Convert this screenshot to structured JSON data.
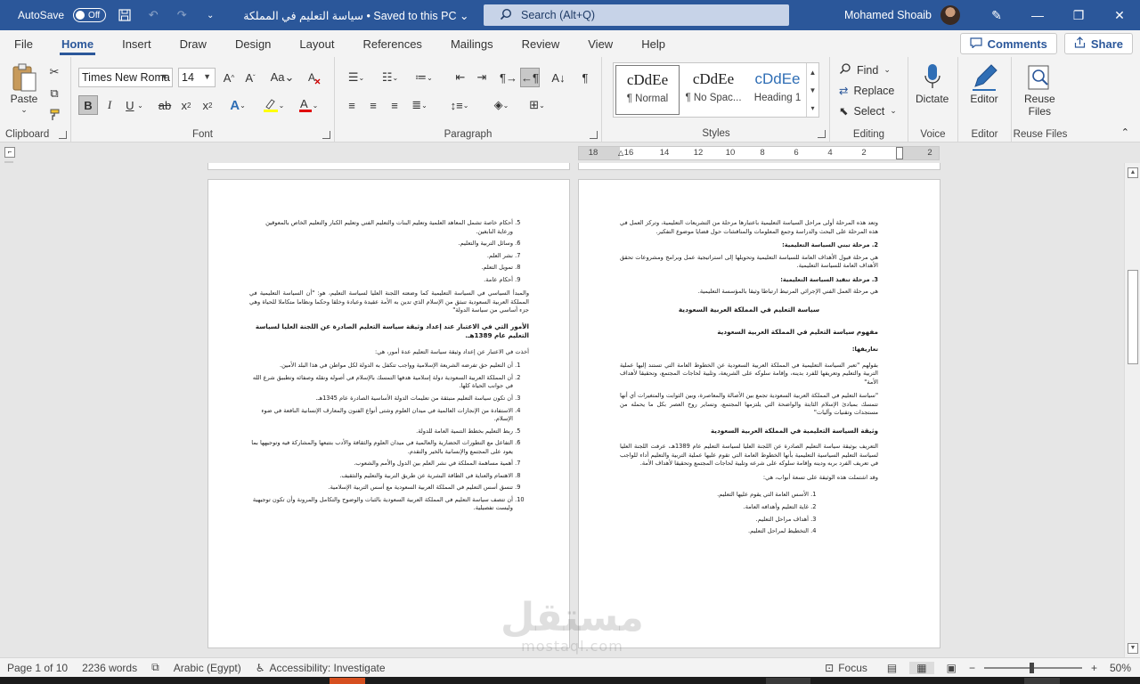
{
  "title_bar": {
    "autosave_label": "AutoSave",
    "autosave_state": "Off",
    "doc_title": "سياسة التعليم في المملكة • Saved to this PC",
    "search_placeholder": "Search (Alt+Q)",
    "user_name": "Mohamed Shoaib",
    "accent_color": "#2b579a"
  },
  "menu": {
    "items": [
      "File",
      "Home",
      "Insert",
      "Draw",
      "Design",
      "Layout",
      "References",
      "Mailings",
      "Review",
      "View",
      "Help"
    ],
    "active": "Home",
    "comments_label": "Comments",
    "share_label": "Share"
  },
  "ribbon": {
    "clipboard": {
      "paste_label": "Paste",
      "group_label": "Clipboard"
    },
    "font": {
      "font_name": "Times New Roma",
      "font_size": "14",
      "group_label": "Font"
    },
    "paragraph": {
      "group_label": "Paragraph"
    },
    "styles": {
      "group_label": "Styles",
      "tiles": [
        {
          "sample": "AaBbCcDdEe",
          "name": "¶ Normal"
        },
        {
          "sample": "AaBbCcDdEe",
          "name": "¶ No Spac..."
        },
        {
          "sample": "AaBbCcDdEe",
          "name": "Heading 1"
        }
      ],
      "sample_display": [
        "cDdEe",
        "cDdEe",
        "cDdEe"
      ]
    },
    "editing": {
      "find": "Find",
      "replace": "Replace",
      "select": "Select",
      "group_label": "Editing"
    },
    "voice": {
      "dictate": "Dictate",
      "group_label": "Voice"
    },
    "editor": {
      "label": "Editor",
      "group_label": "Editor"
    },
    "reuse": {
      "label_line1": "Reuse",
      "label_line2": "Files",
      "group_label": "Reuse Files"
    }
  },
  "ruler": {
    "numbers": [
      "18",
      "16",
      "14",
      "12",
      "10",
      "8",
      "6",
      "4",
      "2",
      "2"
    ]
  },
  "right_page": {
    "intro": "وتعد هذه المرحلة أولى مراحل السياسة التعليمية باعتبارها مرحلة من التشريعات التعليمية، وتركز العمل في هذه المرحلة على البحث والدراسة وجمع المعلومات والمناقشات حول قضايا موضوع التفكير.",
    "stage2_title": "2.  مرحلة تبني السياسة التعليمية:",
    "stage2_text": "هي مرحلة قبول الأهداف العامة للسياسة التعليمية وتحويلها إلى استراتيجية عمل وبرامج ومشروعات تحقق الأهداف العامة للسياسة التعليمية.",
    "stage3_title": "3.  مرحلة تنفيذ السياسة التعليمية:",
    "stage3_text": "هي مرحلة العمل الفني الإجرائي المرتبط ارتباطا وثيقا بالمؤسسة التعليمية.",
    "heading_main": "سياسة التعليم في المملكة العربية السعودية",
    "heading_concept": "مفهوم سياسة التعليم في المملكة العربية السعودية",
    "definitions_title": "تعاريفها:",
    "def1": "بقولهم \"تعبر السياسة التعليمية في المملكة العربية السعودية عن الخطوط العامة التي تستند إليها عملية التربية والتعليم وتعريفها للفرد بدينه، وإقامة سلوكه على الشريعة، وتلبية لحاجات المجتمع، وتحقيقا لأهداف الأمة\"",
    "def2": "\"سياسة التعليم في المملكة العربية السعودية تجمع بين الأصالة والمعاصرة، وبين الثوابت والمتغيرات أي أنها تتمسك بمبادئ الإسلام الثابتة والواضحة التي يلتزمها المجتمع، وتساير روح العصر بكل ما يحمله من مستجدات وتقنيات وآليات\"",
    "heading_doc": "وثيقة السياسة التعليمية في المملكة العربية السعودية",
    "doc_def": "التعريف بوثيقة سياسة التعليم الصادرة عن اللجنة العليا لسياسة التعليم عام 1389هـ، عرفت اللجنة العليا لسياسة التعليم السياسية التعليمية بأنها الخطوط العامة التي تقوم عليها عملية التربية والتعليم أداء للواجب في تعريف الفرد بربه ودينه وإقامة سلوكه على شرعه وتلبية لحاجات المجتمع وتحقيقا لأهداف الأمة.",
    "doc_parts": "وقد اشتملت هذه الوثيقة على تسعة أبواب، هي:",
    "parts": [
      "الأسس العامة التي يقوم عليها التعليم.",
      "غاية التعليم وأهدافه العامة.",
      "أهداف مراحل التعليم.",
      "التخطيط لمراحل التعليم."
    ]
  },
  "left_page": {
    "list_start": [
      "أحكام خاصة تشمل المعاهد العلمية وتعليم البنات والتعليم الفني وتعليم الكبار والتعليم الخاص بالمعوقين ورعاية النابغين.",
      "وسائل التربية والتعليم.",
      "نشر العلم.",
      "تمويل التعلم.",
      "أحكام عامة."
    ],
    "principle": "والمبدأ السياسي في السياسة التعليمية كما وضعته اللجنة العليا لسياسة التعليم، هو: \"أن السياسة التعليمية في المملكة العربية السعودية تنبثق من الإسلام الذي تدين به الأمة عقيدة وعبادة وخلقا وحكما ونظاما متكاملا للحياة وهي جزء أساسي من سياسة الدولة\"",
    "heading_matters": "الأمور التي في الاعتبار عند إعداد وثيقة سياسة التعليم الصادرة عن اللجنة العليا لسياسة التعليم عام 1389هـ.",
    "matters_intro": "أخذت في الاعتبار عن إعداد وثيقة سياسة التعليم عدة أمور، هي:",
    "matters": [
      "أن التعليم حق تفرضه الشريعة الإسلامية وواجب تتكفل به الدولة لكل مواطن في هذا البلد الأمين.",
      "أن المملكة العربية السعودية دولة إسلامية هدفها التمسك بالإسلام في أصوله ونقله وصفائه وتطبيق شرع الله في جوانب الحياة كلها.",
      "أن تكون سياسة التعليم منبثقة من تعليمات الدولة الأساسية الصادرة عام 1345هـ.",
      "الاستفادة من الإنجازات العالمية في ميدان العلوم وشتى أنواع الفنون والمعارف الإنسانية النافعة في ضوء الإسلام.",
      "ربط التعليم بخطط التنمية العامة للدولة.",
      "التفاعل مع التطورات الحضارية والعالمية في ميدان العلوم والثقافة والأدب بتتبعها والمشاركة فيه وتوجيهها بما يعود على المجتمع والإنسانية بالخير والتقدم.",
      "أهمية مساهمة المملكة في نشر العلم بين الدول والأمم والشعوب.",
      "الاهتمام والعناية في الطاقة البشرية عن طريق التربية والتعليم والتثقيف.",
      "تنسق أسس التعليم في المملكة العربية السعودية مع أسس التربية الإسلامية.",
      "أن تتصف سياسة التعليم في المملكة العربية السعودية بالثبات والوضوح والتكامل والمرونة وأن تكون توجيهية وليست تفصيلية."
    ]
  },
  "watermark": {
    "arabic": "مستقل",
    "latin": "mostaql.com"
  },
  "status_bar": {
    "page": "Page 1 of 10",
    "words": "2236 words",
    "language": "Arabic (Egypt)",
    "accessibility": "Accessibility: Investigate",
    "focus": "Focus",
    "zoom": "50%",
    "zoom_fraction": 0.5
  }
}
